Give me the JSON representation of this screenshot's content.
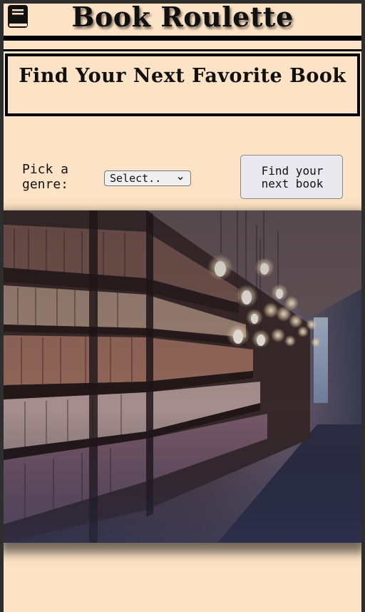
{
  "header": {
    "title": "Book Roulette",
    "logo_icon": "book-icon"
  },
  "hero": {
    "title": "Find Your Next Favorite Book"
  },
  "genre": {
    "label": "Pick a genre:",
    "selected": "Select.."
  },
  "actions": {
    "find_button_label": "Find your next book"
  },
  "image": {
    "subject": "library-bookshelves-with-hanging-bulbs"
  },
  "colors": {
    "page_background": "#fde3c6",
    "frame": "#2e2e2e",
    "text": "#111111",
    "button_background": "#e9e8ee"
  }
}
